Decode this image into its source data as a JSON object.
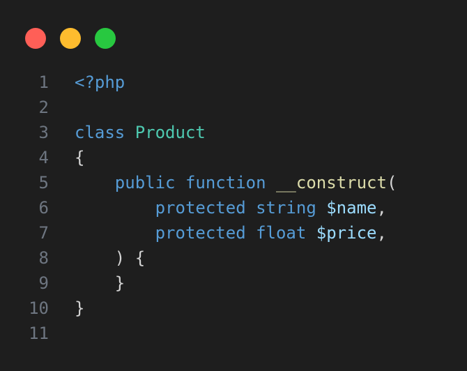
{
  "window": {
    "controls": [
      "close",
      "minimize",
      "maximize"
    ]
  },
  "code": {
    "lines": [
      {
        "number": "1",
        "tokens": [
          {
            "text": "<?php",
            "kind": "keyword"
          }
        ]
      },
      {
        "number": "2",
        "tokens": []
      },
      {
        "number": "3",
        "tokens": [
          {
            "text": "class ",
            "kind": "keyword"
          },
          {
            "text": "Product",
            "kind": "class"
          }
        ]
      },
      {
        "number": "4",
        "tokens": [
          {
            "text": "{",
            "kind": "punct"
          }
        ]
      },
      {
        "number": "5",
        "tokens": [
          {
            "text": "    public function ",
            "kind": "keyword"
          },
          {
            "text": "__construct",
            "kind": "func"
          },
          {
            "text": "(",
            "kind": "punct"
          }
        ]
      },
      {
        "number": "6",
        "tokens": [
          {
            "text": "        protected string ",
            "kind": "keyword"
          },
          {
            "text": "$name",
            "kind": "var"
          },
          {
            "text": ",",
            "kind": "punct"
          }
        ]
      },
      {
        "number": "7",
        "tokens": [
          {
            "text": "        protected float ",
            "kind": "keyword"
          },
          {
            "text": "$price",
            "kind": "var"
          },
          {
            "text": ",",
            "kind": "punct"
          }
        ]
      },
      {
        "number": "8",
        "tokens": [
          {
            "text": "    ) {",
            "kind": "punct"
          }
        ]
      },
      {
        "number": "9",
        "tokens": [
          {
            "text": "    }",
            "kind": "punct"
          }
        ]
      },
      {
        "number": "10",
        "tokens": [
          {
            "text": "}",
            "kind": "punct"
          }
        ]
      },
      {
        "number": "11",
        "tokens": []
      }
    ]
  },
  "colors": {
    "background": "#1e1e1e",
    "line_number": "#6e7681",
    "keyword": "#569cd6",
    "class": "#4ec9b0",
    "function": "#dcdcaa",
    "variable": "#9cdcfe",
    "punctuation": "#d4d4d4",
    "close_dot": "#ff5f57",
    "minimize_dot": "#febc2e",
    "maximize_dot": "#28c840"
  }
}
